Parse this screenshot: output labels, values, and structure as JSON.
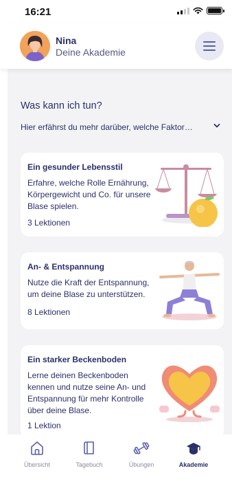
{
  "status_bar": {
    "time": "16:21"
  },
  "header": {
    "user_name": "Nina",
    "subtitle": "Deine Akademie",
    "menu_icon": "hamburger-menu-icon"
  },
  "intro": {
    "title": "Was kann ich tun?",
    "description": "Hier erfährst du mehr darüber, welche Faktor…",
    "toggle_icon": "chevron-down-icon"
  },
  "cards": [
    {
      "title": "Ein gesunder Lebensstil",
      "lines": [
        "Erfahre, welche Rolle Ernährung,",
        "Körpergewicht und Co. für unsere",
        "Blase spielen."
      ],
      "count": "3 Lektionen",
      "illustration": "scale-with-apple-illustration"
    },
    {
      "title": "An- & Entspannung",
      "lines": [
        "Nutze die Kraft der Entspannung,",
        "um deine Blase zu unterstützen."
      ],
      "count": "8 Lektionen",
      "illustration": "yoga-pose-illustration"
    },
    {
      "title": "Ein starker Beckenboden",
      "lines": [
        "Lerne deinen Beckenboden",
        "kennen und nutze seine An- und",
        "Entspannung für mehr Kontrolle",
        "über deine Blase."
      ],
      "count": "1 Lektion",
      "illustration": "bladder-heart-illustration"
    }
  ],
  "tabs": [
    {
      "label": "Übersicht",
      "icon": "home-icon",
      "active": false
    },
    {
      "label": "Tagebuch",
      "icon": "book-icon",
      "active": false
    },
    {
      "label": "Übungen",
      "icon": "dumbbell-icon",
      "active": false
    },
    {
      "label": "Akademie",
      "icon": "graduation-cap-icon",
      "active": true
    }
  ],
  "colors": {
    "primary_text": "#2b2f6b",
    "accent": "#5a5fa8",
    "background": "#f3f3f5",
    "card": "#ffffff",
    "tab_inactive": "#8a8c9c"
  }
}
